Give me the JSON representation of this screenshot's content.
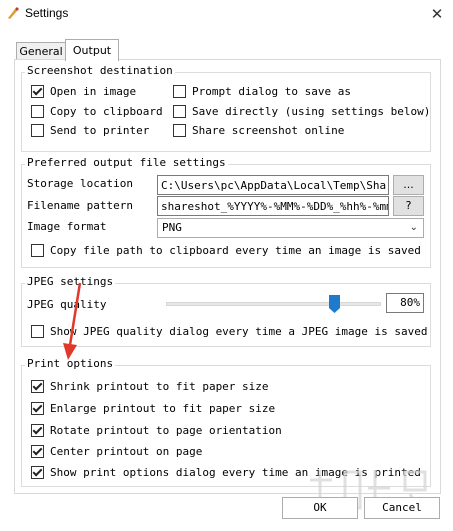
{
  "window": {
    "title": "Settings",
    "close_glyph": "✕"
  },
  "tabs": [
    {
      "label": "General"
    },
    {
      "label": "Output"
    }
  ],
  "screenshot_destination": {
    "title": "Screenshot destination",
    "options": [
      {
        "label": "Open in image",
        "checked": true
      },
      {
        "label": "Copy to clipboard",
        "checked": false
      },
      {
        "label": "Send to printer",
        "checked": false
      },
      {
        "label": "Prompt dialog to save as",
        "checked": false
      },
      {
        "label": "Save directly (using settings below)",
        "checked": false
      },
      {
        "label": "Share screenshot online",
        "checked": false
      }
    ]
  },
  "output_file": {
    "title": "Preferred output file settings",
    "storage_label": "Storage location",
    "storage_value": "C:\\Users\\pc\\AppData\\Local\\Temp\\ShareSh",
    "browse_label": "...",
    "pattern_label": "Filename pattern",
    "pattern_value": "shareshot_%YYYY%-%MM%-%DD%_%hh%-%mm%-%",
    "help_label": "?",
    "format_label": "Image format",
    "format_value": "PNG",
    "copy_path": {
      "label": "Copy file path to clipboard every time an image is saved",
      "checked": false
    }
  },
  "jpeg": {
    "title": "JPEG settings",
    "quality_label": "JPEG quality",
    "quality_value": 80,
    "quality_text": "80%",
    "show_dialog": {
      "label": "Show JPEG quality dialog every time a JPEG image is saved",
      "checked": false
    }
  },
  "print": {
    "title": "Print options",
    "options": [
      {
        "label": "Shrink printout to fit paper size",
        "checked": true
      },
      {
        "label": "Enlarge printout to fit paper size",
        "checked": true
      },
      {
        "label": "Rotate printout to page orientation",
        "checked": true
      },
      {
        "label": "Center printout on page",
        "checked": true
      },
      {
        "label": "Show print options dialog every time an image is printed",
        "checked": true
      }
    ]
  },
  "buttons": {
    "ok": "OK",
    "cancel": "Cancel"
  },
  "colors": {
    "arrow": "#e0392b",
    "slider_thumb": "#1f7acc",
    "watermark": "#cfcfcf"
  },
  "icons": {
    "app": "brush-icon",
    "close": "close-icon",
    "dropdown": "chevron-down-icon"
  }
}
